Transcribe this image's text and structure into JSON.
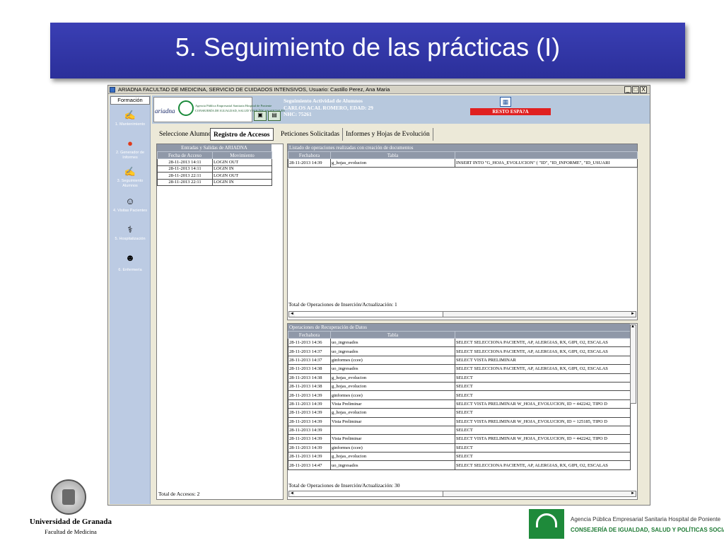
{
  "slide": {
    "title": "5.  Seguimiento de las prácticas (I)"
  },
  "window": {
    "title": "ARIADNA FACULTAD DE MEDICINA, SERVICIO DE CUIDADOS INTENSIVOS, Usuario: Castillo Perez, Ana Maria",
    "controls": [
      "_",
      "□",
      "X"
    ]
  },
  "nav": {
    "tab": "Formación",
    "items": [
      {
        "label": "1. Mantenimiento",
        "icon": "pen-icon"
      },
      {
        "label": "2. Generador de Informes",
        "icon": "record-icon"
      },
      {
        "label": "3. Seguimiento Alumnos",
        "icon": "pen-icon"
      },
      {
        "label": "4. Visitas Pacientes",
        "icon": "people-icon"
      },
      {
        "label": "5. Hospitalización",
        "icon": "stethoscope-icon"
      },
      {
        "label": "6. Enfermería",
        "icon": "nurse-icon"
      }
    ]
  },
  "header": {
    "logo_text": "ariadna",
    "logo_sub1": "Agencia Pública Empresarial Sanitaria Hospital de Poniente",
    "logo_sub2": "CONSEJERÍA DE IGUALDAD, SALUD Y POLÍTICAS SOCIALES",
    "line1": "Seguimiento Actividad de Alumnos",
    "line2": "CARLOS ACAL ROMERO, EDAD: 29",
    "line3": "NHC: 75261",
    "badge": "RESTO ESPA?A"
  },
  "tabs": [
    "Seleccione Alumno",
    "Registro de Accesos",
    "Peticiones Solicitadas",
    "Informes y Hojas de Evolución"
  ],
  "left_grid": {
    "caption": "Entradas y Salidas de ARIADNA",
    "columns": [
      "Fecha de Acceso",
      "Movimiento"
    ],
    "rows": [
      [
        "28-11-2013 14:11",
        "LOGIN OUT"
      ],
      [
        "28-11-2013 14:11",
        "LOGIN IN"
      ],
      [
        "28-11-2013 22:11",
        "LOGIN OUT"
      ],
      [
        "28-11-2013 22:11",
        "LOGIN IN"
      ]
    ],
    "total": "Total de Accesos: 2"
  },
  "grid1": {
    "caption": "Listado de operaciones realizadas con creación de documentos",
    "columns": [
      "Fechahora",
      "Tabla",
      ""
    ],
    "rows": [
      [
        "28-11-2013 14:39",
        "g_hojas_evolucion",
        "INSERT INTO \"G_HOJA_EVOLUCION\" ( \"ID\", \"ID_INFORME\", \"ID_USUARI"
      ]
    ],
    "total": "Total de Operaciones de Inserción/Actualización: 1"
  },
  "grid2": {
    "caption": "Operaciones de Recuperación de Datos",
    "columns": [
      "Fechahora",
      "Tabla",
      ""
    ],
    "rows": [
      [
        "28-11-2013 14:36",
        "uo_ingresados",
        "SELECT SELECCIONA PACIENTE, AP, ALERGIAS, RX, GIPI, O2, ESCALAS"
      ],
      [
        "28-11-2013 14:37",
        "uo_ingresados",
        "SELECT SELECCIONA PACIENTE, AP, ALERGIAS, RX, GIPI, O2, ESCALAS"
      ],
      [
        "28-11-2013 14:37",
        "ginformes (ccee)",
        "SELECT VISTA PRELIMINAR"
      ],
      [
        "28-11-2013 14:38",
        "uo_ingresados",
        "SELECT SELECCIONA PACIENTE, AP, ALERGIAS, RX, GIPI, O2, ESCALAS"
      ],
      [
        "28-11-2013 14:38",
        "g_hojas_evolucion",
        "SELECT"
      ],
      [
        "28-11-2013 14:38",
        "g_hojas_evolucion",
        "SELECT"
      ],
      [
        "28-11-2013 14:39",
        "ginformes (ccee)",
        "SELECT"
      ],
      [
        "28-11-2013 14:39",
        "Vista Preliminar",
        "SELECT VISTA PRELIMINAR W_HOJA_EVOLUCION, ID = 442242, TIPO D"
      ],
      [
        "28-11-2013 14:39",
        "g_hojas_evolucion",
        "SELECT"
      ],
      [
        "28-11-2013 14:39",
        "Vista Preliminar",
        "SELECT VISTA PRELIMINAR W_HOJA_EVOLUCION, ID = 125185, TIPO D"
      ],
      [
        "28-11-2013 14:39",
        "",
        "SELECT"
      ],
      [
        "28-11-2013 14:39",
        "Vista Preliminar",
        "SELECT VISTA PRELIMINAR W_HOJA_EVOLUCION, ID = 442242, TIPO D"
      ],
      [
        "28-11-2013 14:39",
        "ginformes (ccee)",
        "SELECT"
      ],
      [
        "28-11-2013 14:39",
        "g_hojas_evolucion",
        "SELECT"
      ],
      [
        "28-11-2013 14:47",
        "uo_ingresados",
        "SELECT SELECCIONA PACIENTE, AP, ALERGIAS, RX, GIPI, O2, ESCALAS"
      ]
    ],
    "total": "Total de Operaciones de Inserción/Actualización: 30"
  },
  "footer": {
    "university": "Universidad de Granada",
    "faculty": "Facultad de Medicina",
    "agency_line1": "Agencia Pública Empresarial Sanitaria Hospital de Poniente",
    "agency_line2": "CONSEJERÍA DE IGUALDAD, SALUD Y POLÍTICAS SOCIALES"
  }
}
